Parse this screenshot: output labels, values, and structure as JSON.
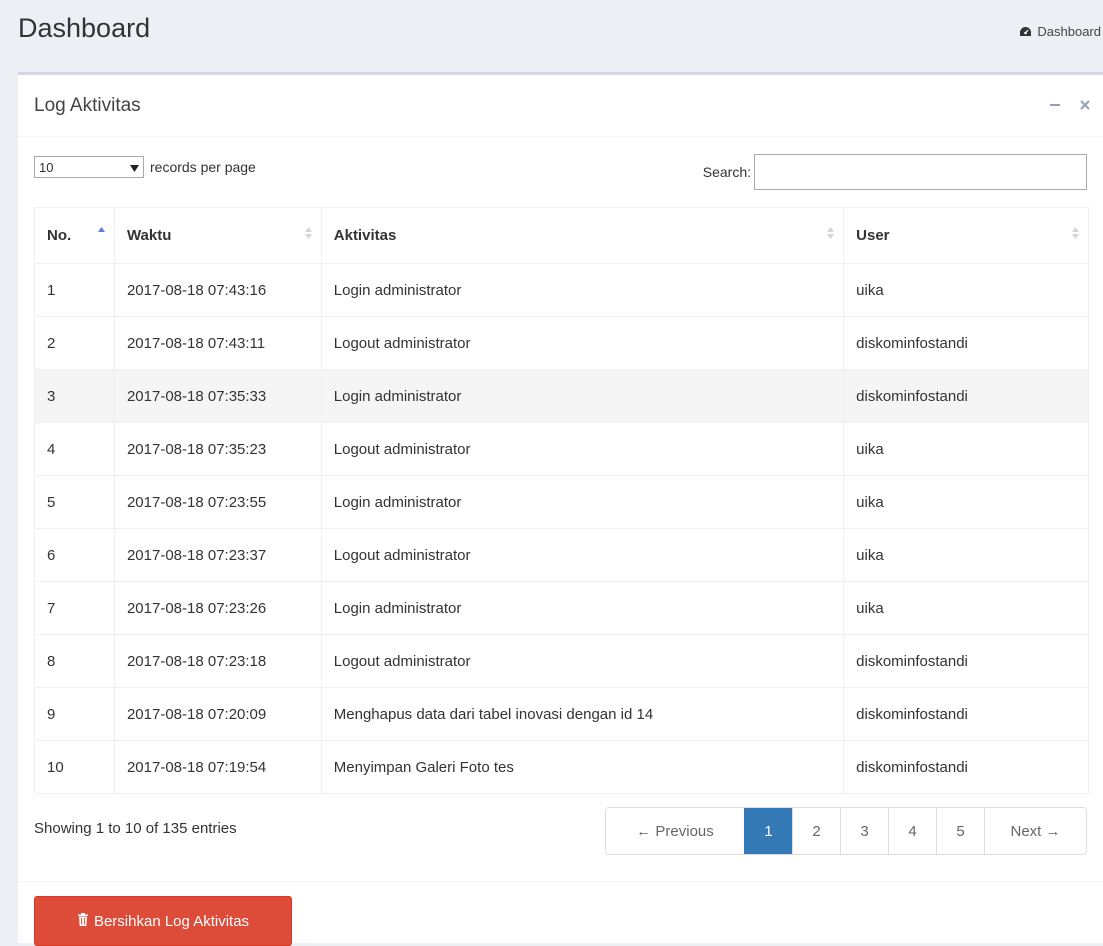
{
  "header": {
    "title": "Dashboard",
    "breadcrumb_label": "Dashboard"
  },
  "panel": {
    "title": "Log Aktivitas"
  },
  "table_controls": {
    "page_length": "10",
    "page_length_suffix": "records per page",
    "search_label": "Search:",
    "search_value": ""
  },
  "table": {
    "columns": [
      "No.",
      "Waktu",
      "Aktivitas",
      "User"
    ],
    "rows": [
      {
        "no": "1",
        "waktu": "2017-08-18 07:43:16",
        "aktivitas": "Login administrator",
        "user": "uika"
      },
      {
        "no": "2",
        "waktu": "2017-08-18 07:43:11",
        "aktivitas": "Logout administrator",
        "user": "diskominfostandi"
      },
      {
        "no": "3",
        "waktu": "2017-08-18 07:35:33",
        "aktivitas": "Login administrator",
        "user": "diskominfostandi"
      },
      {
        "no": "4",
        "waktu": "2017-08-18 07:35:23",
        "aktivitas": "Logout administrator",
        "user": "uika"
      },
      {
        "no": "5",
        "waktu": "2017-08-18 07:23:55",
        "aktivitas": "Login administrator",
        "user": "uika"
      },
      {
        "no": "6",
        "waktu": "2017-08-18 07:23:37",
        "aktivitas": "Logout administrator",
        "user": "uika"
      },
      {
        "no": "7",
        "waktu": "2017-08-18 07:23:26",
        "aktivitas": "Login administrator",
        "user": "uika"
      },
      {
        "no": "8",
        "waktu": "2017-08-18 07:23:18",
        "aktivitas": "Logout administrator",
        "user": "diskominfostandi"
      },
      {
        "no": "9",
        "waktu": "2017-08-18 07:20:09",
        "aktivitas": "Menghapus data dari tabel inovasi dengan id 14",
        "user": "diskominfostandi"
      },
      {
        "no": "10",
        "waktu": "2017-08-18 07:19:54",
        "aktivitas": "Menyimpan Galeri Foto tes",
        "user": "diskominfostandi"
      }
    ]
  },
  "footer": {
    "info": "Showing 1 to 10 of 135 entries"
  },
  "pagination": {
    "previous": "← Previous",
    "pages": [
      "1",
      "2",
      "3",
      "4",
      "5"
    ],
    "active_page": "1",
    "next": "Next →"
  },
  "actions": {
    "clear_log_label": "Bersihkan Log Aktivitas"
  },
  "colors": {
    "primary": "#337ab7",
    "danger": "#dd4b39",
    "background": "#ecf0f5"
  }
}
